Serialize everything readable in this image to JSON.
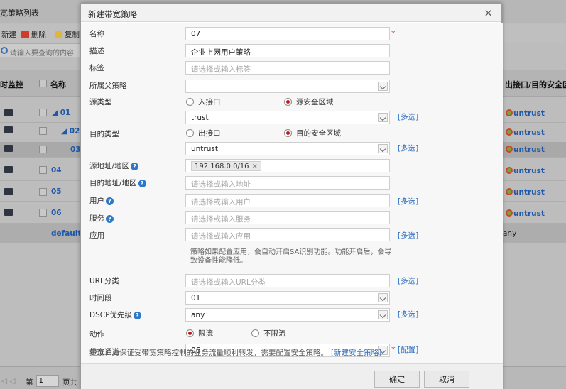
{
  "background": {
    "page_title": "宽策略列表",
    "toolbar": {
      "new": "新建",
      "delete": "删除",
      "copy": "复制"
    },
    "search_placeholder": "请输入要查询的内容",
    "columns": {
      "monitor": "时监控",
      "name": "名称",
      "interface": "出接口/目的安全区"
    },
    "rows": [
      {
        "name": "01",
        "interface": "untrust"
      },
      {
        "name": "02",
        "interface": "untrust"
      },
      {
        "name": "03",
        "interface": "untrust"
      },
      {
        "name": "04",
        "interface": "untrust"
      },
      {
        "name": "05",
        "interface": "untrust"
      },
      {
        "name": "06",
        "interface": "untrust"
      },
      {
        "name": "default",
        "interface": "any"
      }
    ],
    "pager": {
      "page_label": "第",
      "page_value": "1",
      "total_label": "页共 1"
    }
  },
  "modal": {
    "title": "新建带宽策略",
    "close": "×",
    "fields": {
      "name": {
        "label": "名称",
        "value": "07"
      },
      "description": {
        "label": "描述",
        "value": "企业上网用户策略"
      },
      "tags": {
        "label": "标签",
        "placeholder": "请选择或输入标签"
      },
      "parent_policy": {
        "label": "所属父策略",
        "value": ""
      },
      "source_type": {
        "label": "源类型",
        "options": [
          "入接口",
          "源安全区域"
        ],
        "selected": "源安全区域"
      },
      "source_zone": {
        "value": "trust"
      },
      "dest_type": {
        "label": "目的类型",
        "options": [
          "出接口",
          "目的安全区域"
        ],
        "selected": "目的安全区域"
      },
      "dest_zone": {
        "value": "untrust"
      },
      "source_address": {
        "label": "源地址/地区",
        "tag": "192.168.0.0/16"
      },
      "dest_address": {
        "label": "目的地址/地区",
        "placeholder": "请选择或输入地址"
      },
      "user": {
        "label": "用户",
        "placeholder": "请选择或输入用户"
      },
      "service": {
        "label": "服务",
        "placeholder": "请选择或输入服务"
      },
      "application": {
        "label": "应用",
        "placeholder": "请选择或输入应用",
        "note": "策略如果配置应用，会自动开启SA识别功能。功能开启后，会导致设备性能降低。"
      },
      "url_category": {
        "label": "URL分类",
        "placeholder": "请选择或输入URL分类"
      },
      "time_range": {
        "label": "时间段",
        "value": "01"
      },
      "dscp": {
        "label": "DSCP优先级",
        "value": "any"
      },
      "action": {
        "label": "动作",
        "options": [
          "限流",
          "不限流"
        ],
        "selected": "限流"
      },
      "channel": {
        "label": "带宽通道",
        "value": "06",
        "config_link": "[配置]"
      }
    },
    "multi_select_label": "[多选]",
    "required_mark": "*",
    "tip": {
      "text": "提示：为保证受带宽策略控制的业务流量顺利转发，需要配置安全策略。",
      "link": "[新建安全策略]"
    },
    "buttons": {
      "ok": "确定",
      "cancel": "取消"
    }
  },
  "colors": {
    "link": "#2d6fc3",
    "required": "#e02020",
    "radio_on": "#c01818"
  }
}
